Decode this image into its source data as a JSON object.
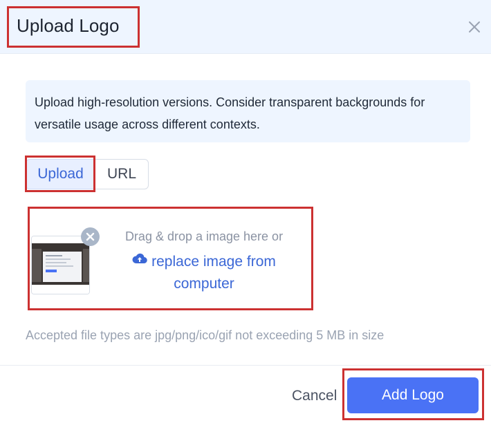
{
  "dialog": {
    "title": "Upload Logo",
    "close_icon": "close-icon"
  },
  "info": {
    "text": "Upload high-resolution versions. Consider transparent backgrounds for versatile usage across different contexts."
  },
  "tabs": [
    {
      "label": "Upload",
      "active": true
    },
    {
      "label": "URL",
      "active": false
    }
  ],
  "dropzone": {
    "hint": "Drag & drop a image here or",
    "link": "replace image from computer",
    "upload_icon": "cloud-upload-icon",
    "remove_icon": "remove-image-icon"
  },
  "accepted_note": "Accepted file types are jpg/png/ico/gif not exceeding 5 MB in size",
  "footer": {
    "cancel": "Cancel",
    "submit": "Add Logo"
  },
  "colors": {
    "accent": "#4a72f5",
    "header_bg": "#eef5ff",
    "highlight": "#cc3131"
  }
}
